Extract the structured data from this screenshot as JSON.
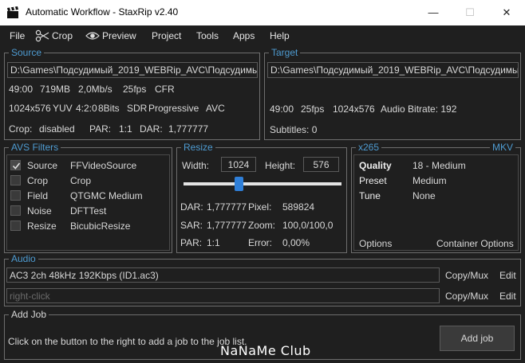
{
  "window": {
    "title": "Automatic Workflow - StaxRip v2.40",
    "minimize": "—",
    "maximize": "☐",
    "close": "✕"
  },
  "menu": {
    "file": "File",
    "crop": "Crop",
    "preview": "Preview",
    "project": "Project",
    "tools": "Tools",
    "apps": "Apps",
    "help": "Help"
  },
  "source": {
    "title": "Source",
    "path": "D:\\Games\\Подсудимый_2019_WEBRip_AVC\\Подсудимый_",
    "line1": [
      "49:00",
      "719MB",
      "2,0Mb/s",
      "25fps",
      "CFR"
    ],
    "line2": [
      "1024x576",
      "YUV",
      "4:2:0",
      "8Bits",
      "SDR",
      "Progressive",
      "AVC"
    ],
    "crop_label": "Crop:",
    "crop_value": "disabled",
    "par_label": "PAR:",
    "par_value": "1:1",
    "dar_label": "DAR:",
    "dar_value": "1,777777"
  },
  "target": {
    "title": "Target",
    "path": "D:\\Games\\Подсудимый_2019_WEBRip_AVC\\Подсудимый_",
    "line1": [
      "49:00",
      "25fps",
      "1024x576",
      "Audio Bitrate: 192"
    ],
    "subtitles": "Subtitles: 0"
  },
  "avs_filters": {
    "title": "AVS Filters",
    "items": [
      {
        "name": "Source",
        "value": "FFVideoSource",
        "checked": true
      },
      {
        "name": "Crop",
        "value": "Crop",
        "checked": false
      },
      {
        "name": "Field",
        "value": "QTGMC Medium",
        "checked": false
      },
      {
        "name": "Noise",
        "value": "DFTTest",
        "checked": false
      },
      {
        "name": "Resize",
        "value": "BicubicResize",
        "checked": false
      }
    ]
  },
  "resize": {
    "title": "Resize",
    "width_label": "Width:",
    "width_value": "1024",
    "height_label": "Height:",
    "height_value": "576",
    "slider_level": 0.34,
    "dar_label": "DAR:",
    "dar_value": "1,777777",
    "pixel_label": "Pixel:",
    "pixel_value": "589824",
    "sar_label": "SAR:",
    "sar_value": "1,777777",
    "zoom_label": "Zoom:",
    "zoom_value": "100,0/100,0",
    "par_label": "PAR:",
    "par_value": "1:1",
    "error_label": "Error:",
    "error_value": "0,00%"
  },
  "encoder": {
    "title": "x265",
    "container": "MKV",
    "rows": [
      {
        "label": "Quality",
        "value": "18 - Medium"
      },
      {
        "label": "Preset",
        "value": "Medium"
      },
      {
        "label": "Tune",
        "value": "None"
      }
    ],
    "options": "Options",
    "container_options": "Container Options"
  },
  "audio": {
    "title": "Audio",
    "track1": "AC3 2ch 48kHz 192Kbps (ID1.ac3)",
    "track2_placeholder": "right-click",
    "copy_mux": "Copy/Mux",
    "edit": "Edit"
  },
  "add_job": {
    "title": "Add Job",
    "hint": "Click on the button to the right to add a job to the job list.",
    "button": "Add job"
  },
  "watermark": "NaNaMe Club",
  "colors": {
    "background": "#1f1f1f",
    "accent": "#4e9bd1",
    "border": "#6e6e6e",
    "slider_thumb": "#2f7fd8"
  }
}
